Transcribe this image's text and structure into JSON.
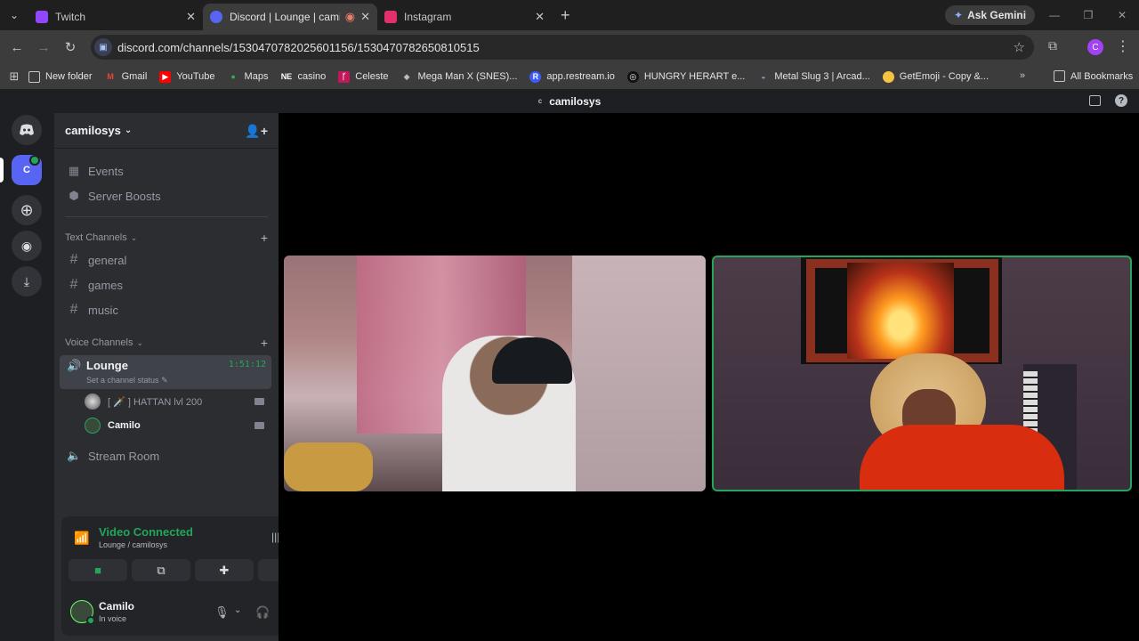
{
  "browser": {
    "tabs": [
      {
        "title": "Twitch",
        "favicon_color": "#9146ff"
      },
      {
        "title": "Discord | Lounge | camilosys",
        "favicon_color": "#5865f2",
        "active": true
      },
      {
        "title": "Instagram",
        "favicon_color": "#e1306c"
      }
    ],
    "ask_gemini": "Ask Gemini",
    "url": "discord.com/channels/1530470782025601156/1530470782650810515",
    "profile_initial": "C",
    "bookmarks": [
      {
        "label": "New folder",
        "icon": "folder-icon"
      },
      {
        "label": "Gmail",
        "icon": "gmail-icon",
        "color": "#ea4335"
      },
      {
        "label": "YouTube",
        "icon": "youtube-icon",
        "color": "#ff0000"
      },
      {
        "label": "Maps",
        "icon": "maps-icon",
        "color": "#34a853"
      },
      {
        "label": "casino",
        "icon": "ne-icon"
      },
      {
        "label": "Celeste",
        "icon": "celeste-icon",
        "color": "#c2185b"
      },
      {
        "label": "Mega Man X (SNES)...",
        "icon": "game-icon"
      },
      {
        "label": "app.restream.io",
        "icon": "restream-icon",
        "color": "#3d5afe"
      },
      {
        "label": "HUNGRY HERART e...",
        "icon": "hungry-icon"
      },
      {
        "label": "Metal Slug 3 | Arcad...",
        "icon": "metalslug-icon"
      },
      {
        "label": "GetEmoji - Copy &...",
        "icon": "emoji-icon",
        "color": "#f6c342"
      }
    ],
    "all_bookmarks": "All Bookmarks"
  },
  "discord": {
    "top_title": "camilosys",
    "server_name": "camilosys",
    "guild_initial": "C",
    "menu": [
      {
        "label": "Events",
        "icon": "calendar-icon"
      },
      {
        "label": "Server Boosts",
        "icon": "boost-icon"
      }
    ],
    "text_category": "Text Channels",
    "text_channels": [
      "general",
      "games",
      "music"
    ],
    "voice_category": "Voice Channels",
    "lounge": {
      "name": "Lounge",
      "timer": "1:51:12",
      "status": "Set a channel status"
    },
    "voice_members": [
      {
        "name": "[ 🗡️ ] HATTAN lvl 200"
      },
      {
        "name": "Camilo"
      }
    ],
    "stream_room": "Stream Room",
    "panel": {
      "title": "Video Connected",
      "subtitle": "Lounge / camilosys"
    },
    "user": {
      "name": "Camilo",
      "status": "In voice"
    }
  }
}
